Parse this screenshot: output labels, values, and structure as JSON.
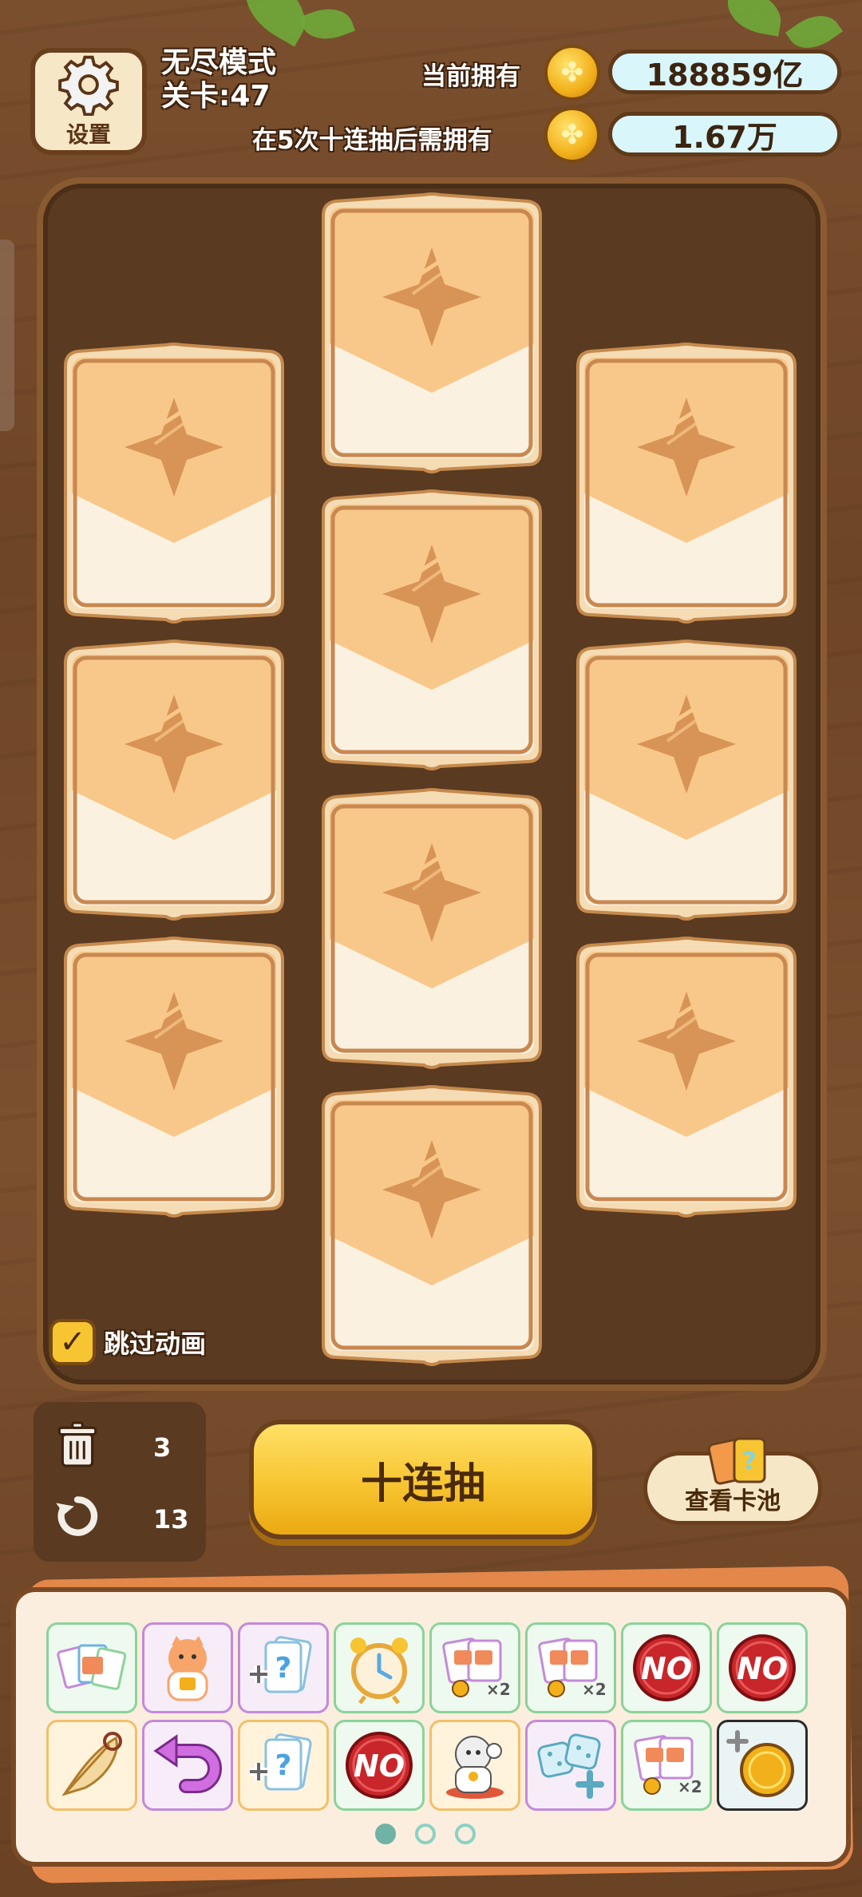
{
  "header": {
    "settings_label": "设置",
    "mode": "无尽模式",
    "level": "关卡:47",
    "current_label": "当前拥有",
    "current_value": "188859亿",
    "after_label": "在5次十连抽后需拥有",
    "after_value": "1.67万"
  },
  "board": {
    "skip_animation_label": "跳过动画",
    "skip_animation_checked": true
  },
  "controls": {
    "trash_count": "3",
    "refresh_count": "13",
    "draw_button_label": "十连抽",
    "view_pool_label": "查看卡池"
  },
  "items_page": {
    "total_pages": 3,
    "active_page": 1
  },
  "items": [
    {
      "name": "card-pack",
      "border": "green"
    },
    {
      "name": "lucky-cat",
      "border": "purple"
    },
    {
      "name": "add-random-card",
      "border": "purple"
    },
    {
      "name": "alarm-clock",
      "border": "green"
    },
    {
      "name": "double-cards",
      "border": "green"
    },
    {
      "name": "double-cards",
      "border": "green"
    },
    {
      "name": "no-stamp",
      "border": "green"
    },
    {
      "name": "no-stamp",
      "border": "green"
    },
    {
      "name": "feather",
      "border": "orange"
    },
    {
      "name": "undo-arrow",
      "border": "purple"
    },
    {
      "name": "add-random-card",
      "border": "orange"
    },
    {
      "name": "no-stamp",
      "border": "green"
    },
    {
      "name": "lucky-cat-white",
      "border": "orange"
    },
    {
      "name": "dice-plus",
      "border": "purple"
    },
    {
      "name": "double-cards",
      "border": "green"
    },
    {
      "name": "add-coin",
      "border": "dark"
    }
  ],
  "colors": {
    "wood": "#6e4526",
    "card_top": "#f8c88a",
    "card_bottom": "#faf1e1",
    "button_yellow": "#f7c531",
    "value_pill": "#d9f6fb"
  }
}
